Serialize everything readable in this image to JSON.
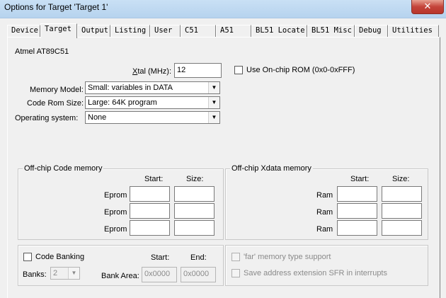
{
  "window": {
    "title": "Options for Target 'Target 1'",
    "close_glyph": "✕"
  },
  "tabs": [
    {
      "label": "Device",
      "active": false
    },
    {
      "label": "Target",
      "active": true
    },
    {
      "label": "Output",
      "active": false
    },
    {
      "label": "Listing",
      "active": false
    },
    {
      "label": "User",
      "active": false
    },
    {
      "label": "C51",
      "active": false
    },
    {
      "label": "A51",
      "active": false
    },
    {
      "label": "BL51 Locate",
      "active": false
    },
    {
      "label": "BL51 Misc",
      "active": false
    },
    {
      "label": "Debug",
      "active": false
    },
    {
      "label": "Utilities",
      "active": false
    }
  ],
  "device_name": "Atmel AT89C51",
  "xtal": {
    "mnemonic": "X",
    "rest": "tal (MHz):",
    "value": "12"
  },
  "onchip_rom": {
    "label": "Use On-chip ROM (0x0-0xFFF)",
    "checked": false
  },
  "memory_model": {
    "label": "Memory Model:",
    "value": "Small: variables in DATA"
  },
  "code_rom_size": {
    "label": "Code Rom Size:",
    "value": "Large: 64K program"
  },
  "operating_system": {
    "label": "Operating system:",
    "value": "None"
  },
  "code_memory": {
    "title": "Off-chip Code memory",
    "start_header": "Start:",
    "size_header": "Size:",
    "rows": [
      {
        "label": "Eprom",
        "start": "",
        "size": ""
      },
      {
        "label": "Eprom",
        "start": "",
        "size": ""
      },
      {
        "label": "Eprom",
        "start": "",
        "size": ""
      }
    ]
  },
  "xdata_memory": {
    "title": "Off-chip Xdata memory",
    "start_header": "Start:",
    "size_header": "Size:",
    "rows": [
      {
        "label": "Ram",
        "start": "",
        "size": ""
      },
      {
        "label": "Ram",
        "start": "",
        "size": ""
      },
      {
        "label": "Ram",
        "start": "",
        "size": ""
      }
    ]
  },
  "code_banking": {
    "label": "Code Banking",
    "checked": false,
    "start_header": "Start:",
    "end_header": "End:",
    "banks_label": "Banks:",
    "banks_value": "2",
    "bank_area_label": "Bank Area:",
    "bank_area_start": "0x0000",
    "bank_area_end": "0x0000"
  },
  "far_memory": {
    "label": "'far' memory type support",
    "checked": false
  },
  "save_sfr": {
    "label": "Save address extension SFR in interrupts",
    "checked": false
  },
  "icons": {
    "dropdown_arrow": "▼",
    "close": "close-icon"
  }
}
